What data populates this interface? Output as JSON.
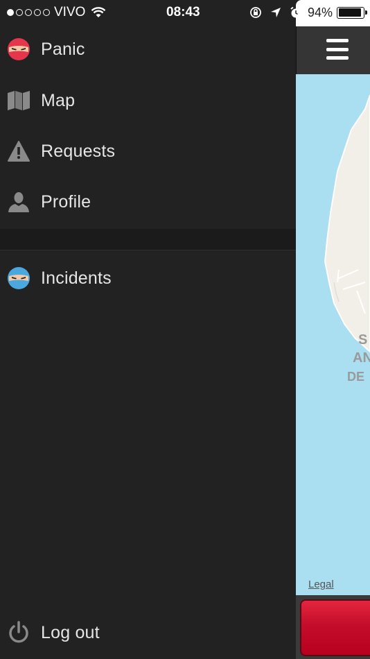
{
  "status_bar": {
    "carrier": "VIVO",
    "time": "08:43",
    "battery_percent": "94%",
    "battery_level": 0.94,
    "signal_bars_filled": 1,
    "signal_bars_total": 5
  },
  "menu": {
    "items": [
      {
        "label": "Panic",
        "icon": "ninja-red-icon"
      },
      {
        "label": "Map",
        "icon": "map-icon"
      },
      {
        "label": "Requests",
        "icon": "warning-icon"
      },
      {
        "label": "Profile",
        "icon": "person-icon"
      }
    ],
    "secondary_items": [
      {
        "label": "Incidents",
        "icon": "ninja-blue-icon"
      }
    ],
    "logout": {
      "label": "Log out",
      "icon": "power-icon"
    }
  },
  "map": {
    "labels": [
      "S",
      "AN",
      "DE"
    ],
    "legal_link": "Legal"
  },
  "colors": {
    "menu_background": "#222222",
    "water": "#aadff2",
    "land": "#f2efe9",
    "panic_red": "#c40d2a",
    "incident_blue": "#4aa8de"
  }
}
